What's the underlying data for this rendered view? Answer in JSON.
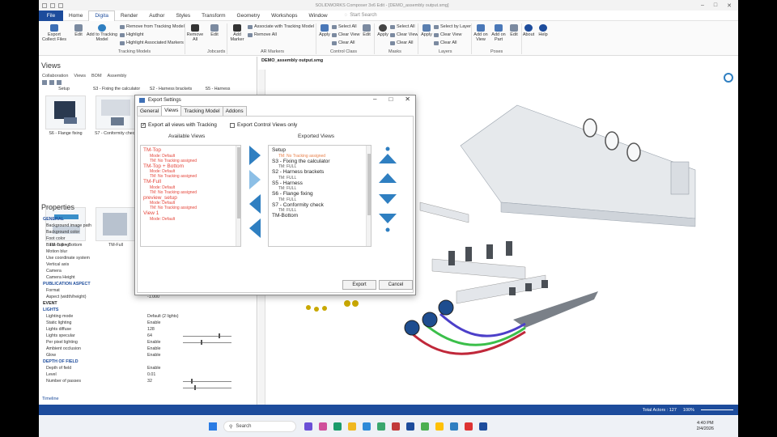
{
  "window": {
    "title": "SOLIDWORKS Composer 3x6 Edit - [DEMO_assembly output.smg]"
  },
  "menubar": {
    "file": "File",
    "tabs": [
      "Home",
      "Digita",
      "Render",
      "Author",
      "Styles",
      "Transform",
      "Geometry",
      "Workshops",
      "Window"
    ],
    "active_tab": "Digita",
    "search_placeholder": "Start Search"
  },
  "ribbon": {
    "tracking_models": {
      "export_collect": "Export Collect Files",
      "edit": "Edit",
      "add_to": "Add to Tracking Model",
      "remove_from": "Remove from Tracking Model",
      "highlight": "Highlight",
      "highlight_assoc": "Highlight Associated Markers",
      "group": "Tracking Models"
    },
    "jobcards": {
      "remove_all": "Remove All",
      "edit": "Edit",
      "group": "Jobcards"
    },
    "ar_markers": {
      "add_marker": "Add Marker",
      "associate": "Associate with Tracking Model",
      "remove_all": "Remove All",
      "group": "AR Markers"
    },
    "control_class": {
      "apply": "Apply",
      "select_all": "Select All",
      "clear_view": "Clear View",
      "clear_all": "Clear All",
      "edit": "Edit",
      "group": "Control Class"
    },
    "masks": {
      "apply": "Apply",
      "select_all": "Select All",
      "clear_view": "Clear View",
      "clear_all": "Clear All",
      "group": "Masks"
    },
    "layers": {
      "apply": "Apply",
      "select_by_layer": "Select by Layer",
      "clear_view": "Clear View",
      "clear_all": "Clear All",
      "group": "Layers"
    },
    "poses": {
      "add_on_view": "Add on View",
      "add_on_part": "Add on Part",
      "edit": "Edit",
      "group": "Poses"
    },
    "about": {
      "label": "About",
      "help": "Help"
    }
  },
  "views_panel": {
    "title": "Views",
    "subtabs": [
      "Collaboration",
      "Views",
      "BOM",
      "Assembly"
    ],
    "thumbnails": [
      "Setup",
      "S3 - Fixing the calculator",
      "S2 - Harness brackets",
      "S5 - Harness",
      "S6 - Flange fixing",
      "S7 - Conformity check",
      "TM-Top + Bottom",
      "TM-Full"
    ]
  },
  "properties": {
    "title": "Properties",
    "rows": [
      {
        "label": "GENERAL",
        "section": true
      },
      {
        "label": "Background image path"
      },
      {
        "label": "Background color"
      },
      {
        "label": "Foot color"
      },
      {
        "label": "Back culling"
      },
      {
        "label": "Motion blur"
      },
      {
        "label": "Use coordinate system"
      },
      {
        "label": "Vertical axis"
      },
      {
        "label": "Camera"
      },
      {
        "label": "Camera Height"
      },
      {
        "label": "PUBLICATION ASPECT",
        "section": true
      },
      {
        "label": "Format",
        "value": "Free"
      },
      {
        "label": "Aspect (width/height)",
        "value": "-1.000"
      },
      {
        "label": "EVENT",
        "section": true,
        "dark": true
      },
      {
        "label": "LIGHTS",
        "section": true
      },
      {
        "label": "Lighting mode",
        "value": "Default (2 lights)"
      },
      {
        "label": "Static lighting",
        "value": "Enable"
      },
      {
        "label": "Lights diffuse",
        "value": "128"
      },
      {
        "label": "Lights specular",
        "value": "64"
      },
      {
        "label": "Per pixel lighting",
        "value": "Enable"
      },
      {
        "label": "Ambient occlusion",
        "value": "Enable"
      },
      {
        "label": "Glow",
        "value": "Enable"
      },
      {
        "label": "DEPTH OF FIELD",
        "section": true
      },
      {
        "label": "Depth of field",
        "value": "Enable"
      },
      {
        "label": "Level",
        "value": "0.01"
      },
      {
        "label": "Number of passes",
        "value": "32"
      }
    ],
    "timeline": "Timeline"
  },
  "viewport": {
    "doc_tab": "DEMO_assembly output.smg"
  },
  "dialog": {
    "title": "Export Settings",
    "tabs": [
      "General",
      "Views",
      "Tracking Model",
      "Addons"
    ],
    "active_tab": "Views",
    "export_all": "Export all views with Tracking",
    "export_control": "Export Control Views only",
    "available_header": "Available Views",
    "exported_header": "Exported Views",
    "available": [
      {
        "name": "TM-Top",
        "mode": "Mode: Default",
        "tm": "TM: No Tracking assigned"
      },
      {
        "name": "TM-Top + Bottom",
        "mode": "Mode: Default",
        "tm": "TM: No Tracking assigned"
      },
      {
        "name": "TM-Full",
        "mode": "Mode: Default",
        "tm": "TM: No Tracking assigned"
      },
      {
        "name": "preview_setup",
        "mode": "Mode: Default",
        "tm": "TM: No Tracking assigned"
      },
      {
        "name": "View 1",
        "mode": "Mode: Default",
        "tm": ""
      }
    ],
    "exported": [
      {
        "name": "Setup",
        "tm": "TM: No Tracking assigned",
        "warn": true
      },
      {
        "name": "S3 - Fixing the calculator",
        "tm": "TM: FULL"
      },
      {
        "name": "S2 - Harness brackets",
        "tm": "TM: FULL"
      },
      {
        "name": "S5 - Harness",
        "tm": "TM: FULL"
      },
      {
        "name": "S6 - Flange fixing",
        "tm": "TM: FULL"
      },
      {
        "name": "S7 - Conformity check",
        "tm": "TM: FULL"
      },
      {
        "name": "TM-Bottom",
        "tm": ""
      }
    ],
    "export_btn": "Export",
    "cancel_btn": "Cancel"
  },
  "statusbar": {
    "total_actors": "Total Actors : 127",
    "zoom": "100%"
  },
  "taskbar": {
    "search": "Search",
    "time": "4:40 PM",
    "date": "2/4/2026"
  },
  "colors": {
    "accent": "#1d4c9c",
    "arrow": "#2f7fc1",
    "warn": "#e4453a"
  }
}
